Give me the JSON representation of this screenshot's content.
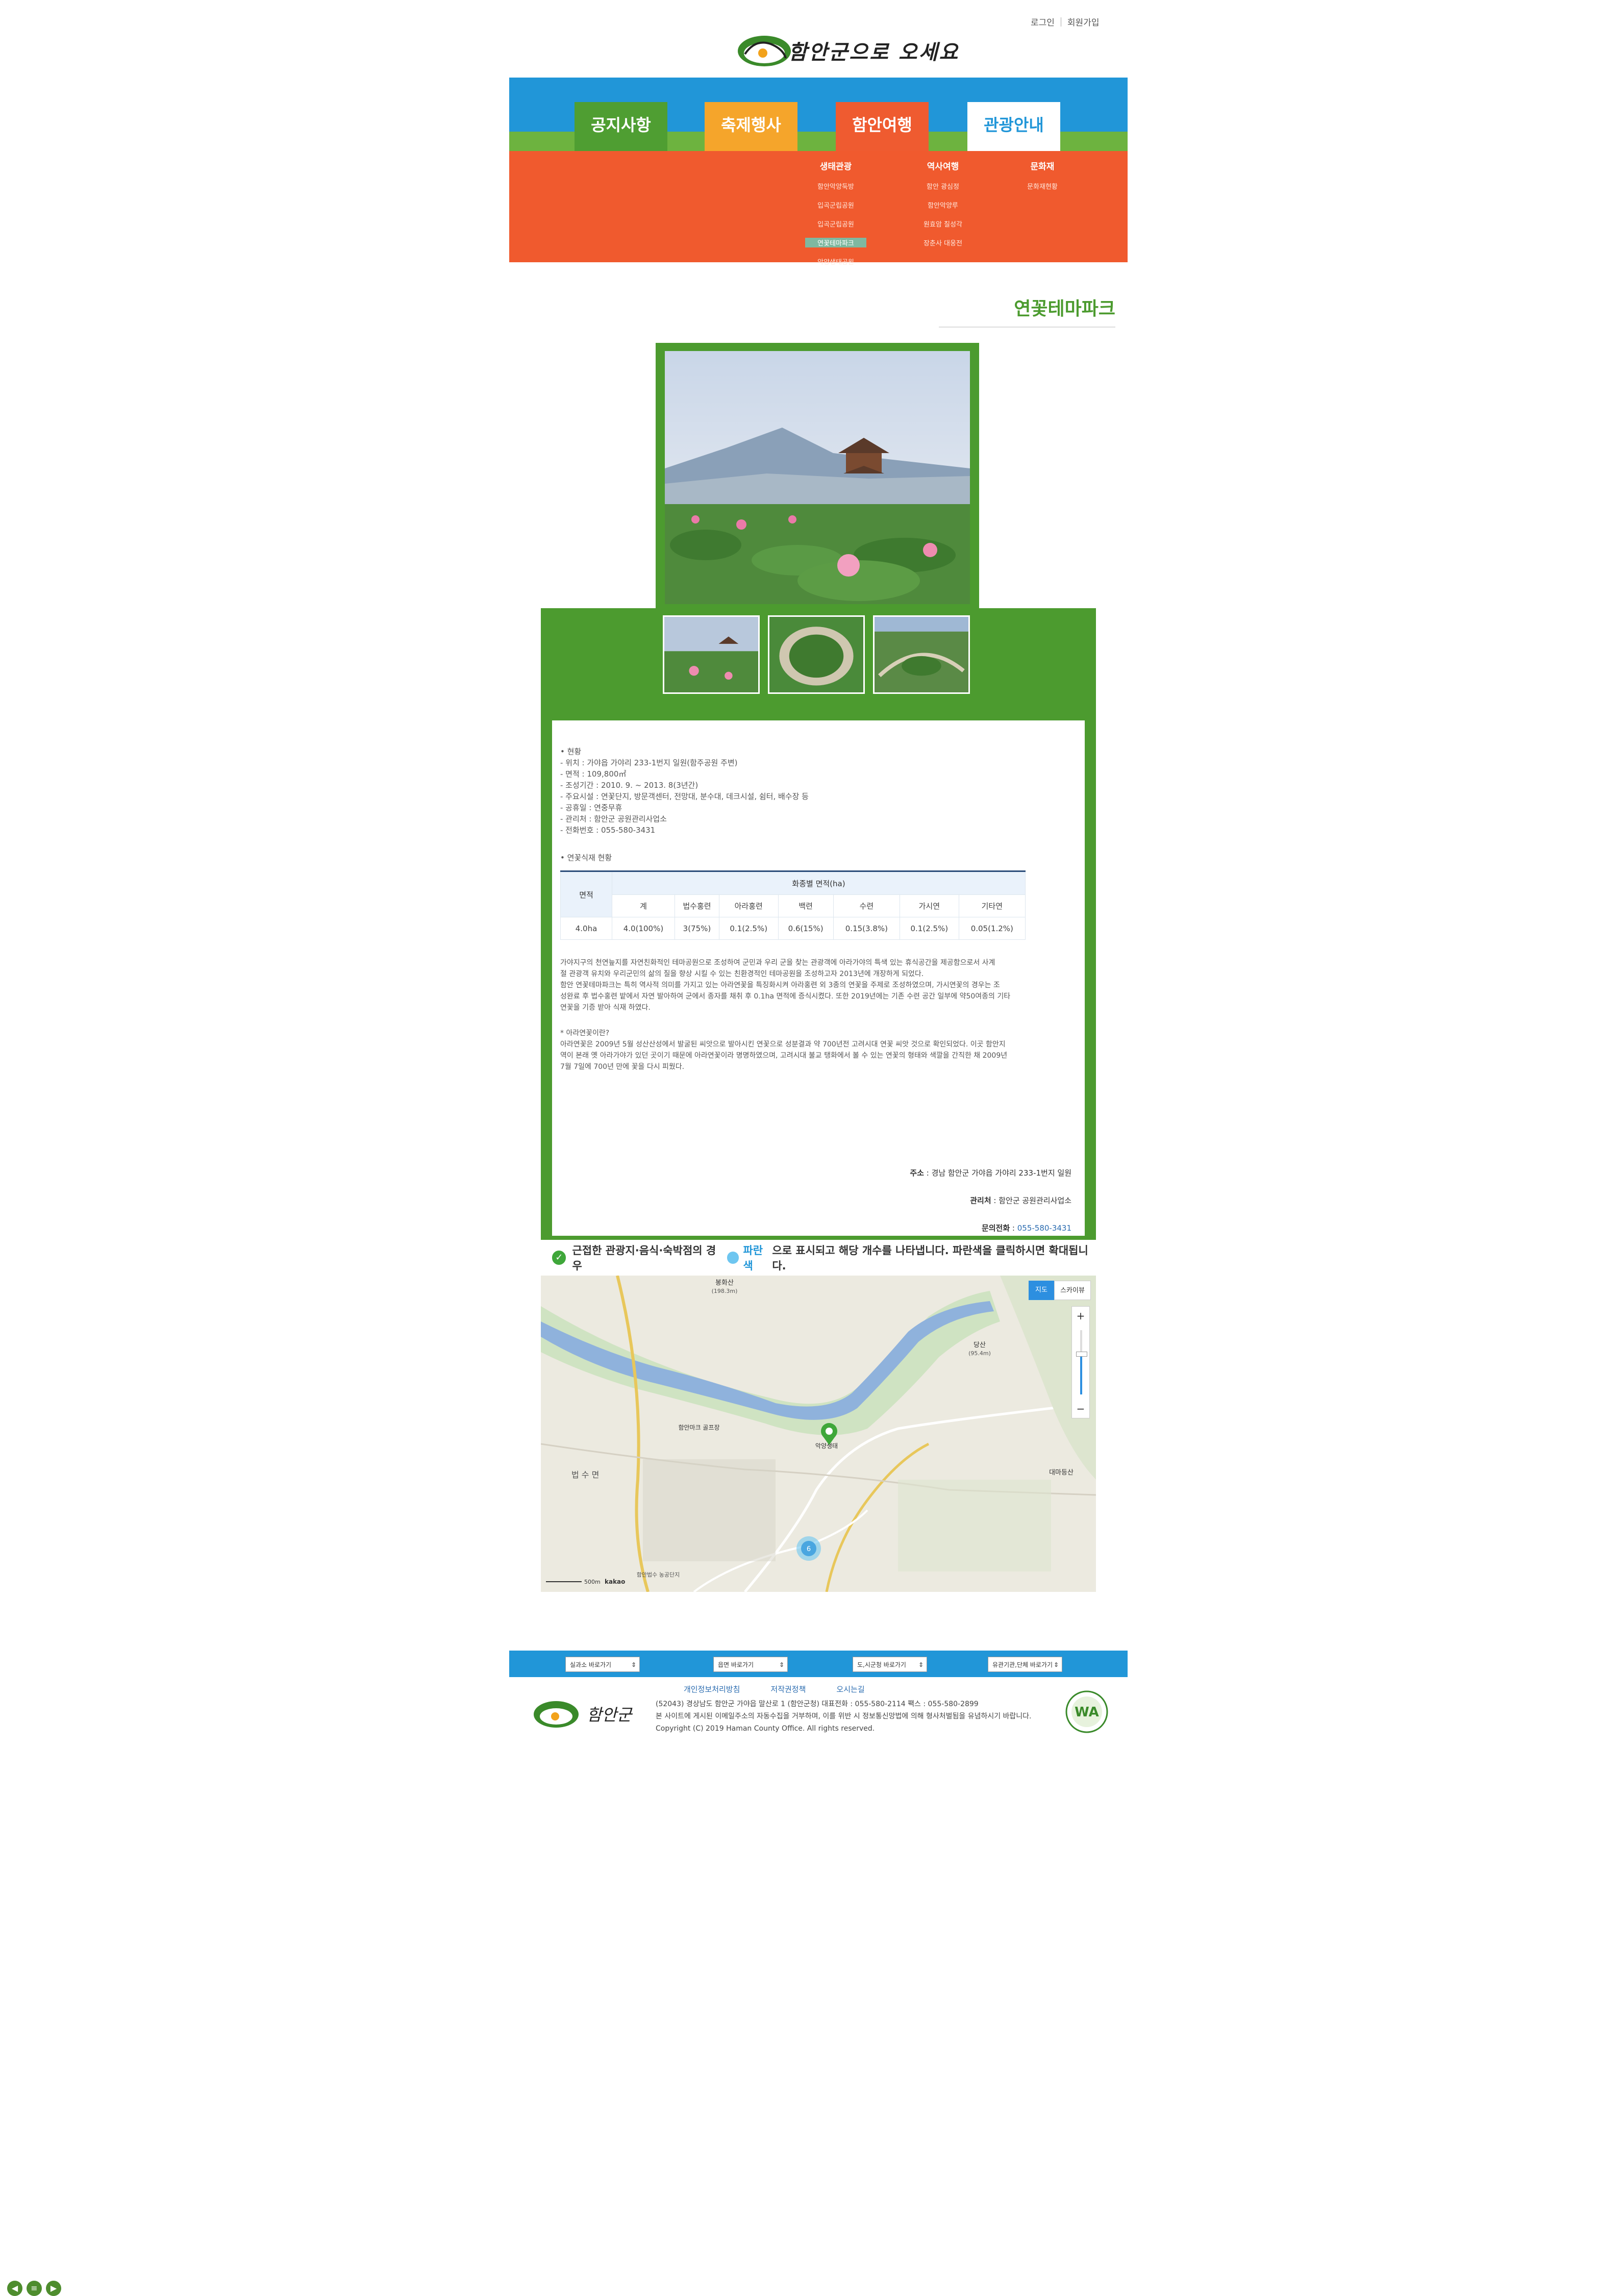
{
  "top_links": {
    "login": "로그인",
    "join": "회원가입"
  },
  "logo": {
    "text": "함안군으로 오세요"
  },
  "main_tabs": [
    "공지사항",
    "축제행사",
    "함안여행",
    "관광안내"
  ],
  "submenu": {
    "col1": {
      "heading": "생태관광",
      "items": [
        "함안악양둑방",
        "입곡군립공원",
        "입곡군립공원",
        "연꽃테마파크",
        "악양생태공원"
      ]
    },
    "col2": {
      "heading": "역사여행",
      "items": [
        "함안 광심정",
        "함안악양루",
        "원효암 칠성각",
        "장춘사 대웅전"
      ]
    },
    "col3": {
      "heading": "문화재",
      "items": [
        "문화재현황"
      ]
    }
  },
  "page_title": "연꽃테마파크",
  "content": {
    "status_heading": "• 현황",
    "status_lines": [
      "- 위치 : 가야읍 가야리 233-1번지 일원(함주공원 주변)",
      "- 면적 : 109,800㎡",
      "- 조성기간 : 2010. 9. ~ 2013. 8(3년간)",
      "- 주요시설 : 연꽃단지, 방문객센터, 전망대, 분수대, 데크시설, 쉼터, 배수장 등",
      "- 공휴일 : 연중무휴",
      "- 관리처 : 함안군 공원관리사업소",
      "- 전화번호 : 055-580-3431"
    ],
    "planting_heading": "• 연꽃식재 현황",
    "table": {
      "area_header": "면적",
      "group_header": "화종별 면적(ha)",
      "columns": [
        "계",
        "법수홍련",
        "아라홍련",
        "백련",
        "수련",
        "가시연",
        "기타연"
      ],
      "row_area": "4.0ha",
      "row_values": [
        "4.0(100%)",
        "3(75%)",
        "0.1(2.5%)",
        "0.6(15%)",
        "0.15(3.8%)",
        "0.1(2.5%)",
        "0.05(1.2%)"
      ]
    },
    "desc1": [
      "가야지구의 천연늪지를 자연친화적인 테마공원으로 조성하여 군민과 우리 군을 찾는 관광객에 아라가야의 특색 있는 휴식공간을 제공함으로서 사계",
      "절 관광객 유치와 우리군민의 삶의 질을 향상 시킬 수 있는 친환경적인 테마공원을 조성하고자 2013년에 개장하게 되었다.",
      "함안 연꽃테마파크는 특히 역사적 의미를 가지고 있는 아라연꽃을 특징화시켜 아라홍련 외 3종의 연꽃을 주제로 조성하였으며, 가시연꽃의 경우는 조",
      "성완료 후 법수홍련 밭에서 자연 발아하여 군에서 종자를 채취 후 0.1ha 면적에 증식시켰다. 또한 2019년에는 기존 수련 공간 일부에 약50여종의 기타",
      "연꽃을 기증 받아 식재 하였다."
    ],
    "desc2_heading": "* 아라연꽃이란?",
    "desc2": [
      "아라연꽃은 2009년 5월 성산산성에서 발굴된 씨앗으로 발아시킨 연꽃으로 성분결과 약 700년전 고려시대 연꽃 씨앗 것으로 확인되었다. 이곳 함안지",
      "역이 본래 옛 아라가야가 있던 곳이기 때문에 아라연꽃이라 명명하였으며, 고려시대 불교 탱화에서 볼 수 있는 연꽃의 형태와 색깔을 간직한 채 2009년",
      "7월 7일에 700년 만에 꽃을 다시 피웠다."
    ],
    "address_label": "주소",
    "address_value": "경남 함안군 가야읍 가야리 233-1번지 일원",
    "manager_label": "관리처",
    "manager_value": "함안군 공원관리사업소",
    "phone_label": "문의전화",
    "phone_value": "055-580-3431"
  },
  "notice": {
    "text_before": "근접한 관광지·음식·숙박점의 경우",
    "blue_word": "파란색",
    "text_after": "으로 표시되고 해당 개수를 나타냅니다. 파란색을 클릭하시면 확대됩니다."
  },
  "map": {
    "btn_map": "지도",
    "btn_sky": "스카이뷰",
    "zoom_in": "+",
    "zoom_out": "−",
    "labels": {
      "bongsan": "봉화산",
      "bongsan_h": "(198.3m)",
      "seoksan": "당산",
      "seoksan_h": "(95.4m)",
      "park": "함안마크 골프장",
      "current": "악양생태",
      "beopsu": "법 수 면",
      "daemun": "대마등산",
      "cluster": "6",
      "bottom": "함안법수 농공단지",
      "scale": "500m",
      "brand": "kakao"
    }
  },
  "footer": {
    "selects": [
      "실과소 바로가기",
      "읍면 바로가기",
      "도,시군청 바로가기",
      "유관기관,단체 바로가기"
    ],
    "links": [
      "개인정보처리방침",
      "저작권정책",
      "오시는길"
    ],
    "info": [
      "(52043) 경상남도 함안군 가야읍 말산로 1 (함안군청)      대표전화 : 055-580-2114      팩스 : 055-580-2899",
      "본 사이트에 게시된 이메일주소의 자동수집을 거부하며, 이를 위반 시 정보통신망법에 의해 형사처벌됨을 유념하시기 바랍니다.",
      "Copyright (C) 2019 Haman County Office. All rights reserved."
    ],
    "logo_text": "함안군",
    "wa_text": "WA"
  },
  "colors": {
    "blue": "#2196d8",
    "green": "#4c9b2f",
    "orange": "#f05a2e",
    "yellow": "#f5a52b"
  }
}
